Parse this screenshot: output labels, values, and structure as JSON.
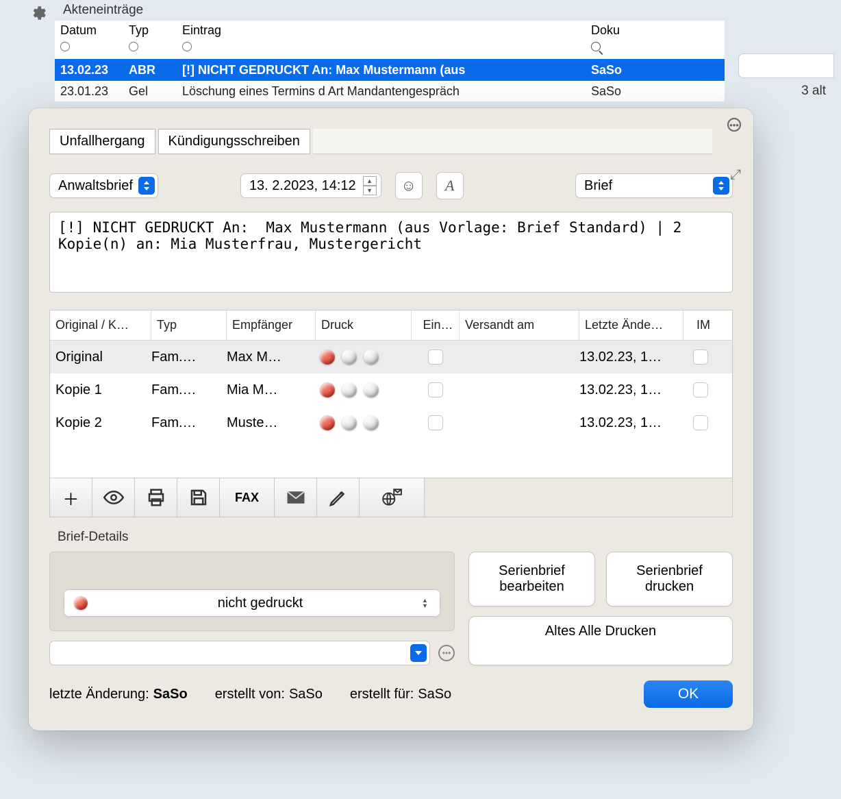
{
  "bg": {
    "title": "Akteneinträge",
    "headers": {
      "datum": "Datum",
      "typ": "Typ",
      "eintrag": "Eintrag",
      "doku": "Doku"
    },
    "rows": [
      {
        "datum": "13.02.23",
        "typ": "ABR",
        "eintrag": "[!] NICHT GEDRUCKT An:  Max Mustermann (aus",
        "doku": "SaSo",
        "selected": true
      },
      {
        "datum": "23.01.23",
        "typ": "Gel",
        "eintrag": "Löschung eines Termins d    Art Mandantengespräch",
        "doku": "SaSo"
      }
    ],
    "sideText": "3 alt"
  },
  "dialog": {
    "tabs": [
      "Unfallhergang",
      "Kündigungsschreiben"
    ],
    "typeSelect": "Anwaltsbrief",
    "dateField": "13.  2.2023, 14:12",
    "rightSelect": "Brief",
    "mainText": "[!] NICHT GEDRUCKT An:  Max Mustermann (aus Vorlage: Brief Standard) | 2 Kopie(n) an: Mia Musterfrau, Mustergericht",
    "table": {
      "headers": {
        "ok": "Original / K…",
        "typ": "Typ",
        "emp": "Empfänger",
        "druck": "Druck",
        "ein": "Ein…",
        "ver": "Versandt am",
        "let": "Letzte Ände…",
        "im": "IM"
      },
      "rows": [
        {
          "ok": "Original",
          "typ": "Fam.…",
          "emp": "Max M…",
          "let": "13.02.23, 1…"
        },
        {
          "ok": "Kopie 1",
          "typ": "Fam.…",
          "emp": "Mia M…",
          "let": "13.02.23, 1…"
        },
        {
          "ok": "Kopie 2",
          "typ": "Fam.…",
          "emp": "Muste…",
          "let": "13.02.23, 1…"
        }
      ]
    },
    "toolbar": {
      "fax": "FAX"
    },
    "detailsLabel": "Brief-Details",
    "statusText": "nicht gedruckt",
    "buttons": {
      "serialEdit": "Serienbrief bearbeiten",
      "serialPrint": "Serienbrief drucken",
      "oldAllPrint": "Altes Alle Drucken"
    },
    "footer": {
      "lastChangeLabel": "letzte Änderung:",
      "lastChangeVal": "SaSo",
      "createdByLabel": "erstellt von:",
      "createdByVal": "SaSo",
      "createdForLabel": "erstellt für:",
      "createdForVal": "SaSo",
      "ok": "OK"
    }
  }
}
